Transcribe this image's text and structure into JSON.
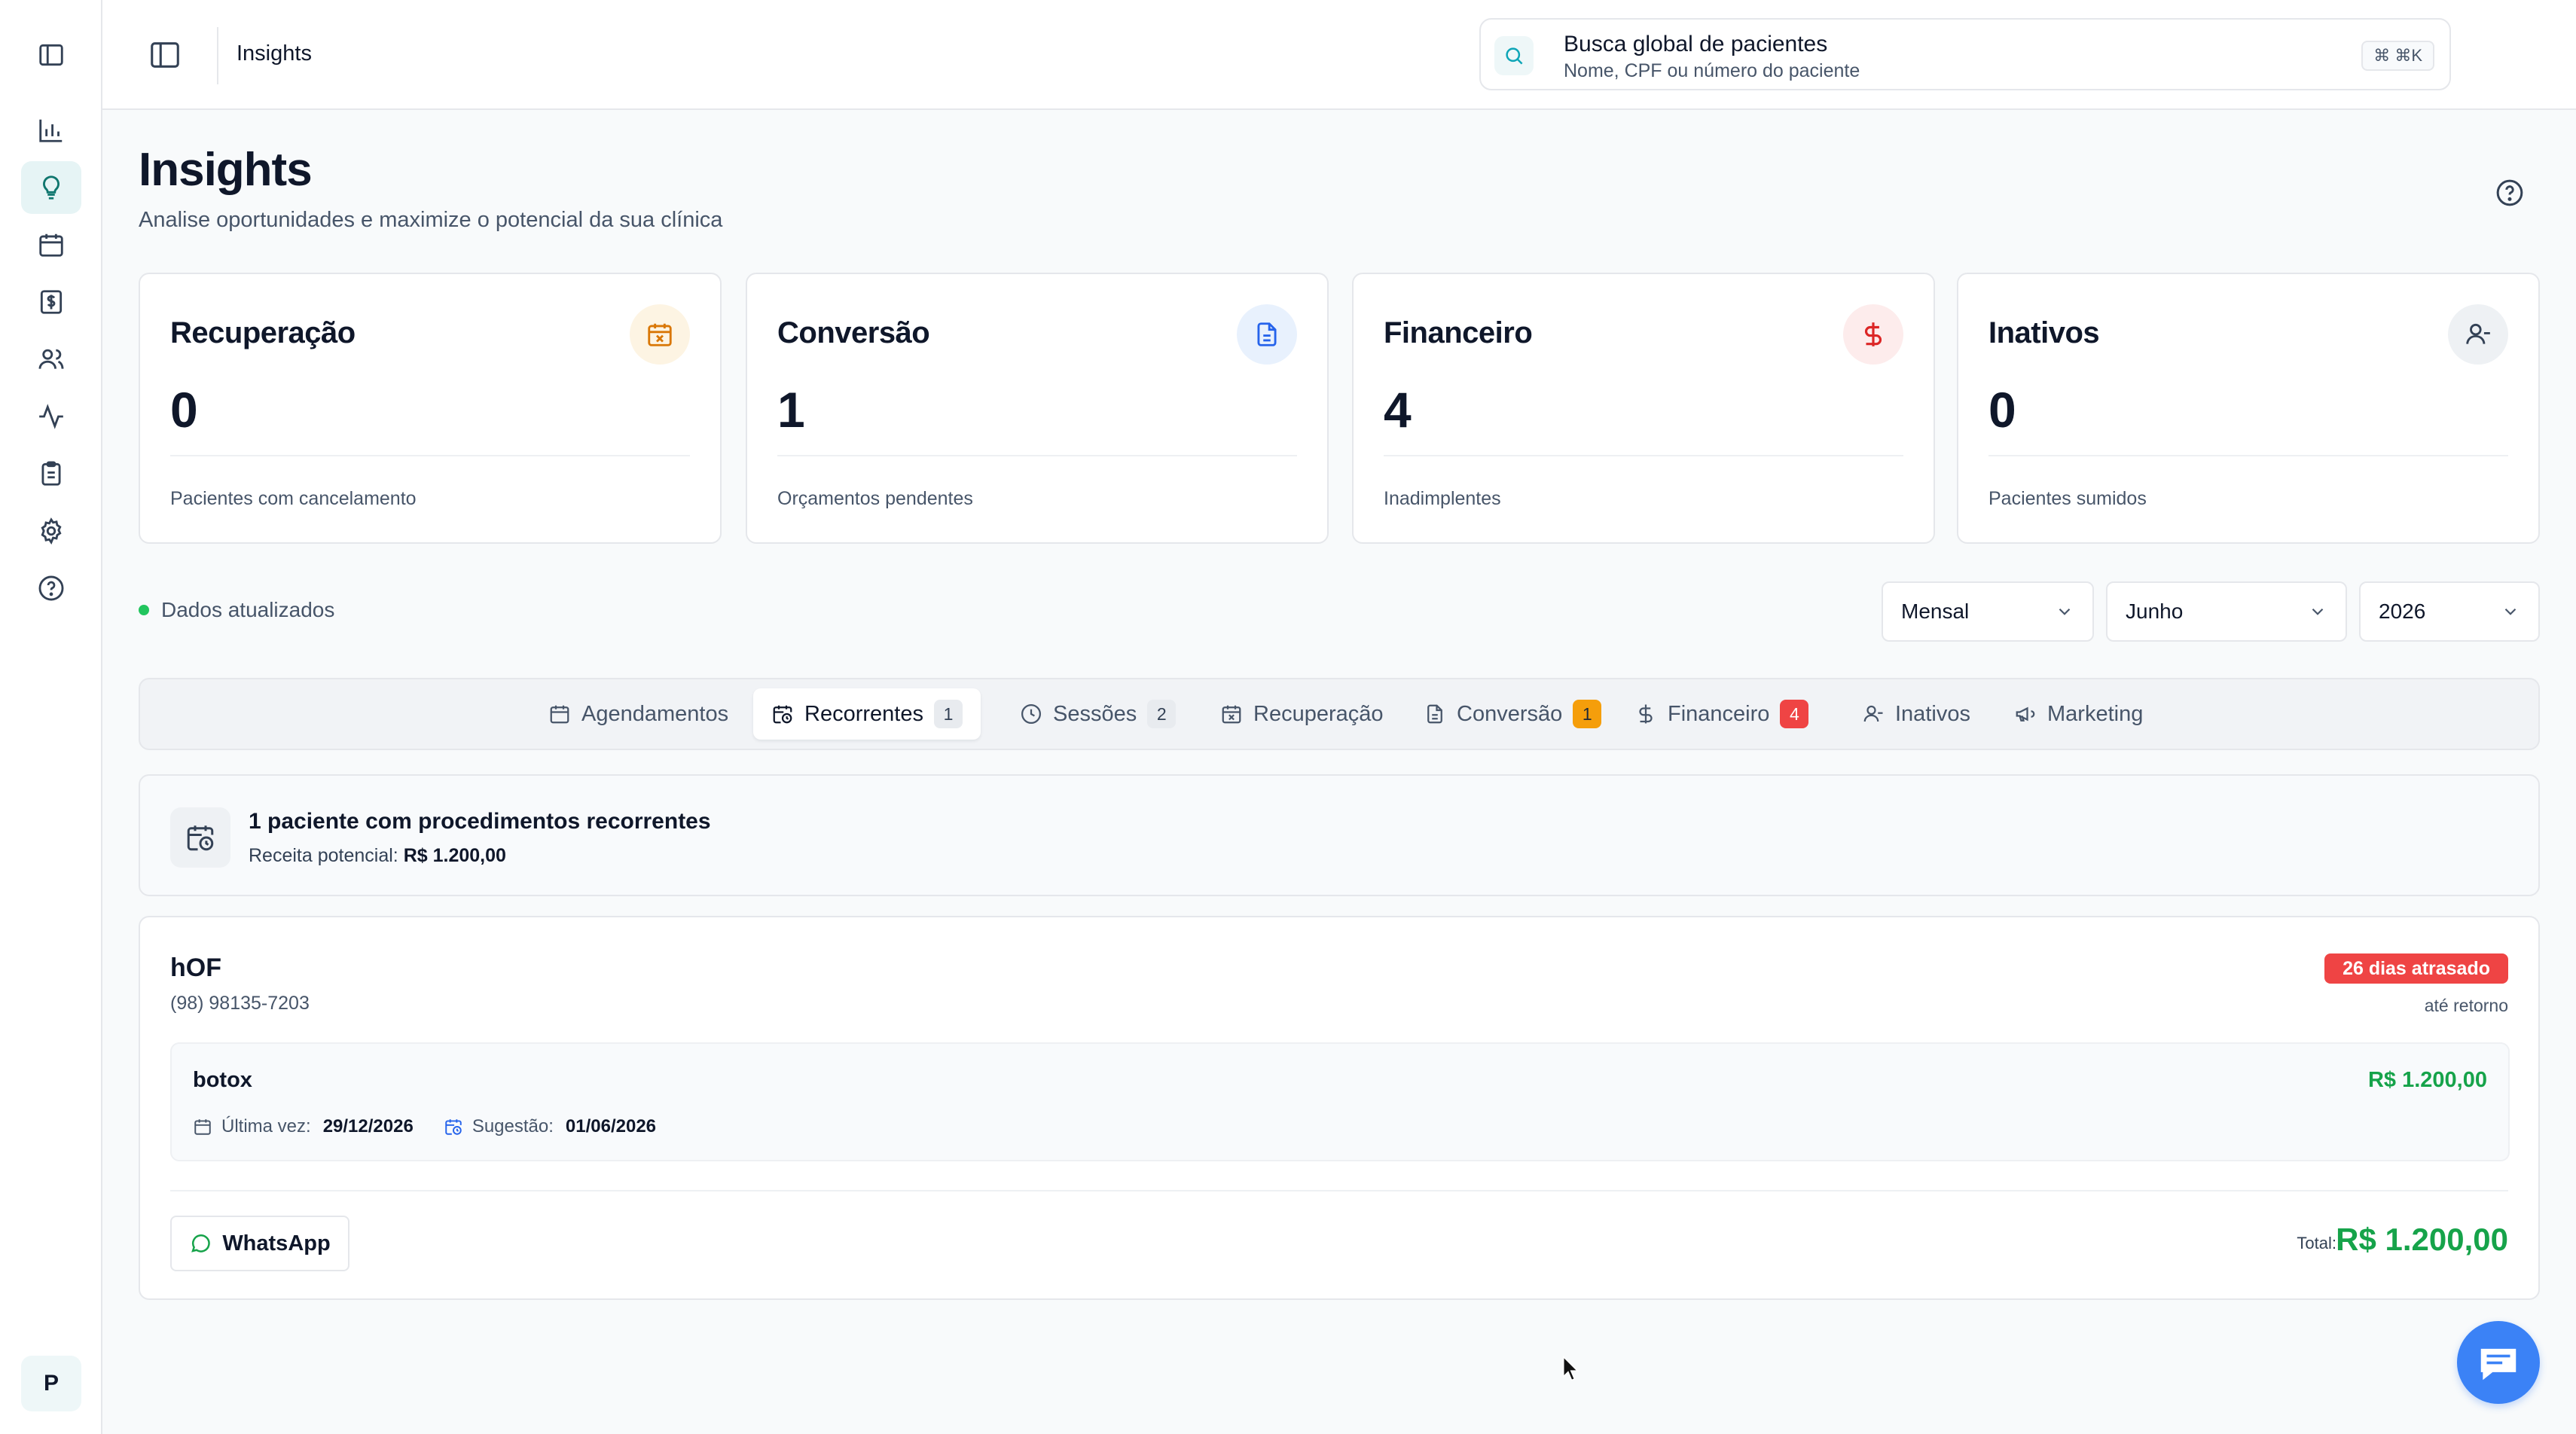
{
  "topbar": {
    "breadcrumb": "Insights",
    "search": {
      "title": "Busca global de pacientes",
      "subtitle": "Nome, CPF ou número do paciente",
      "shortcut": "⌘ ⌘K"
    }
  },
  "sidebar": {
    "items": [
      {
        "icon": "panel-toggle-icon"
      },
      {
        "icon": "bar-chart-icon"
      },
      {
        "icon": "lightbulb-icon",
        "active": true
      },
      {
        "icon": "calendar-icon"
      },
      {
        "icon": "receipt-dollar-icon"
      },
      {
        "icon": "users-icon"
      },
      {
        "icon": "activity-icon"
      },
      {
        "icon": "clipboard-icon"
      },
      {
        "icon": "gear-icon"
      },
      {
        "icon": "help-circle-icon"
      }
    ],
    "avatar_initial": "P"
  },
  "page": {
    "title": "Insights",
    "subtitle": "Analise oportunidades e maximize o potencial da sua clínica"
  },
  "cards": [
    {
      "title": "Recuperação",
      "value": "0",
      "caption": "Pacientes com cancelamento",
      "icon": "calendar-x-icon",
      "accent": "#d97706"
    },
    {
      "title": "Conversão",
      "value": "1",
      "caption": "Orçamentos pendentes",
      "icon": "document-icon",
      "accent": "#2563eb"
    },
    {
      "title": "Financeiro",
      "value": "4",
      "caption": "Inadimplentes",
      "icon": "dollar-icon",
      "accent": "#dc2626"
    },
    {
      "title": "Inativos",
      "value": "0",
      "caption": "Pacientes sumidos",
      "icon": "user-minus-icon",
      "accent": "#334155"
    }
  ],
  "status": {
    "text": "Dados atualizados",
    "color": "#22c55e"
  },
  "filters": {
    "period": "Mensal",
    "month": "Junho",
    "year": "2026"
  },
  "tabs": [
    {
      "label": "Agendamentos",
      "icon": "calendar-icon"
    },
    {
      "label": "Recorrentes",
      "icon": "calendar-clock-icon",
      "badge": "1",
      "active": true
    },
    {
      "label": "Sessões",
      "icon": "clock-icon",
      "badge": "2"
    },
    {
      "label": "Recuperação",
      "icon": "calendar-x-icon"
    },
    {
      "label": "Conversão",
      "icon": "document-icon",
      "badge": "1"
    },
    {
      "label": "Financeiro",
      "icon": "dollar-icon",
      "badge": "4"
    },
    {
      "label": "Inativos",
      "icon": "user-minus-icon"
    },
    {
      "label": "Marketing",
      "icon": "megaphone-icon"
    }
  ],
  "summary": {
    "title": "1 paciente com procedimentos recorrentes",
    "revenue_label": "Receita potencial:",
    "revenue_value": "R$ 1.200,00"
  },
  "patient": {
    "name": "hOF",
    "phone": "(98) 98135-7203",
    "late_badge": "26 dias atrasado",
    "late_sub": "até retorno",
    "procedure": {
      "name": "botox",
      "price": "R$ 1.200,00",
      "last_label": "Última vez:",
      "last_value": "29/12/2026",
      "suggest_label": "Sugestão:",
      "suggest_value": "01/06/2026"
    },
    "whatsapp_label": "WhatsApp",
    "total_label": "Total:",
    "total_value": "R$ 1.200,00"
  },
  "colors": {
    "brand": "#0f766e",
    "success": "#16a34a",
    "danger": "#ef4444",
    "warning": "#f59e0b",
    "chat": "#3b82f6"
  }
}
